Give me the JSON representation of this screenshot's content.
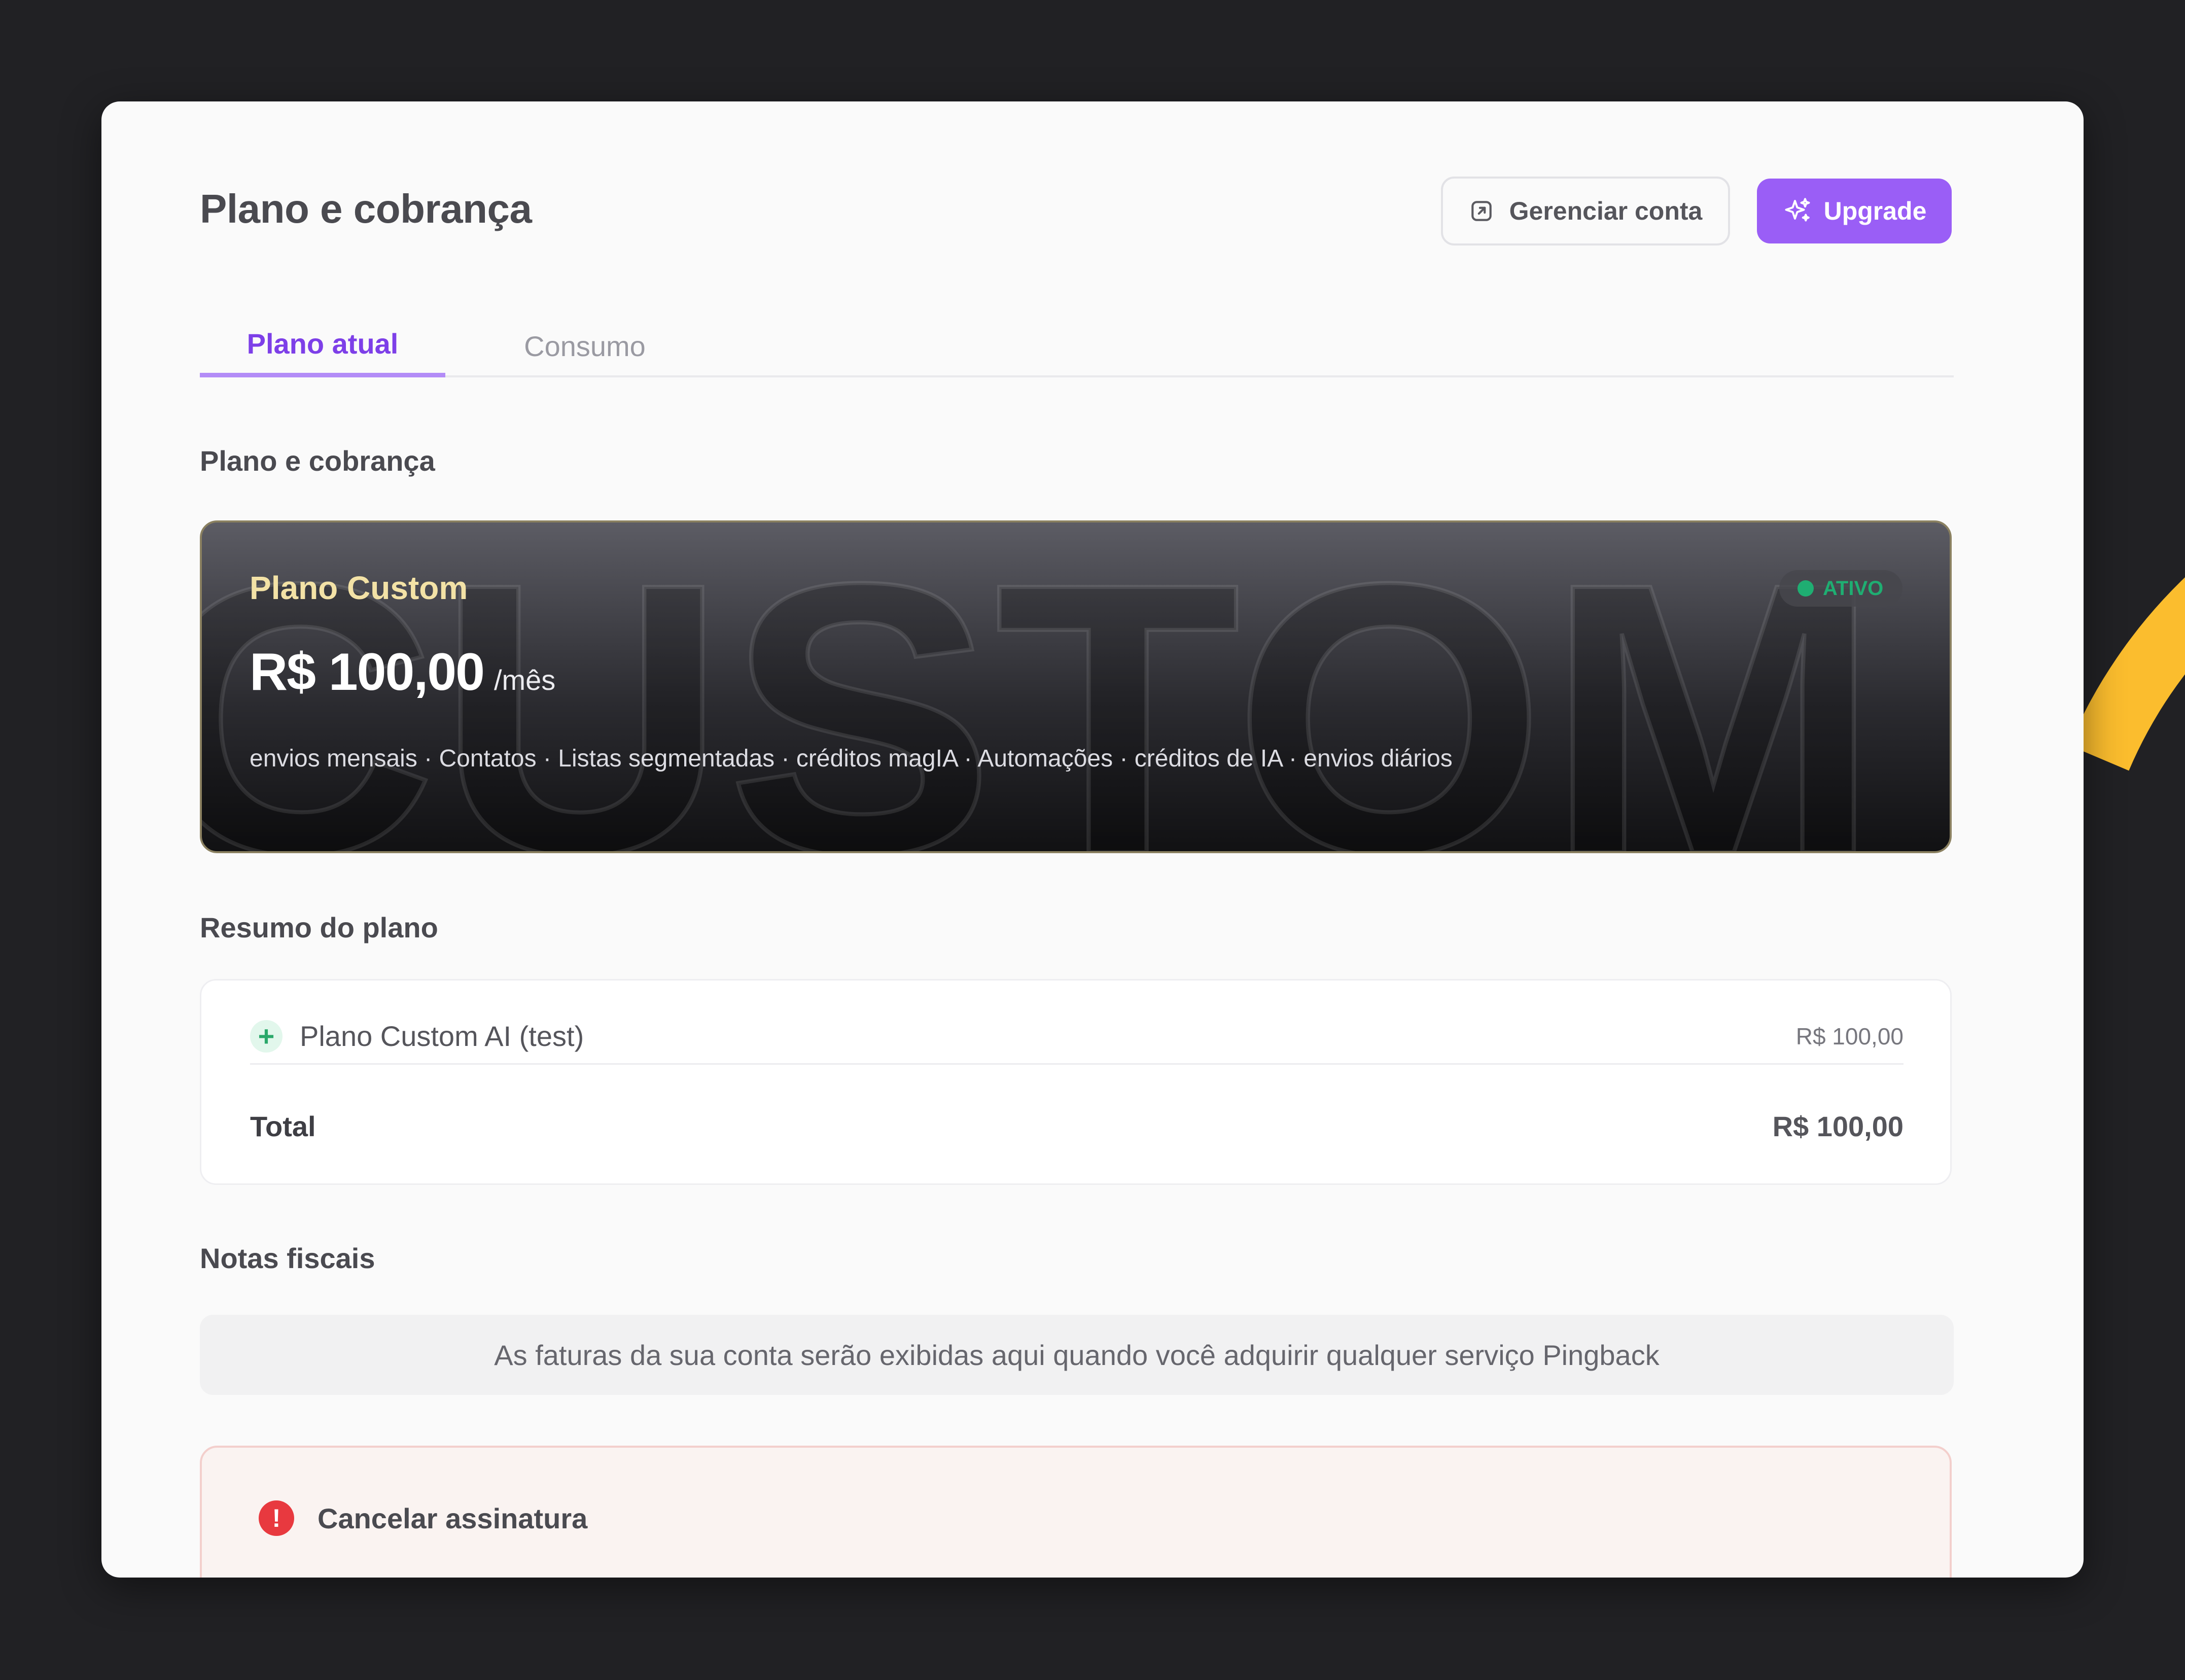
{
  "header": {
    "title": "Plano e cobrança",
    "manage_label": "Gerenciar conta",
    "upgrade_label": "Upgrade"
  },
  "tabs": [
    {
      "label": "Plano atual",
      "active": true
    },
    {
      "label": "Consumo",
      "active": false
    }
  ],
  "sections": {
    "plan": "Plano e cobrança",
    "summary": "Resumo do plano",
    "invoices": "Notas fiscais"
  },
  "plan_card": {
    "watermark": "CUSTOM",
    "name": "Plano Custom",
    "price": "R$ 100,00",
    "period": "/mês",
    "features": "envios mensais · Contatos · Listas segmentadas · créditos magIA · Automações · créditos de IA · envios diários",
    "status": "ATIVO"
  },
  "summary": {
    "items": [
      {
        "name": "Plano Custom AI (test)",
        "price": "R$ 100,00"
      }
    ],
    "total_label": "Total",
    "total_value": "R$ 100,00"
  },
  "invoices": {
    "empty_message": "As faturas da sua conta serão exibidas aqui quando você adquirir qualquer serviço Pingback"
  },
  "cancel": {
    "title": "Cancelar assinatura"
  },
  "colors": {
    "accent": "#9a5ef6",
    "tab_active": "#7d3fe8",
    "status_green": "#1fae72",
    "danger": "#e8393f",
    "background": "#212124",
    "decor_yellow": "#fbbd2e"
  }
}
